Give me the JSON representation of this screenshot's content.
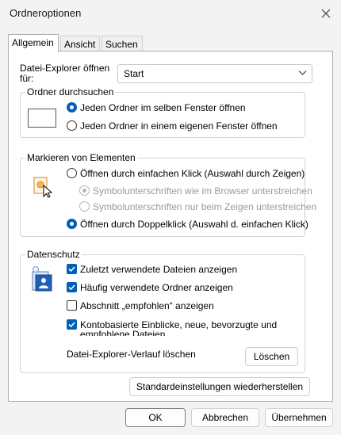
{
  "window": {
    "title": "Ordneroptionen"
  },
  "tabs": [
    {
      "label": "Allgemein",
      "active": true
    },
    {
      "label": "Ansicht",
      "active": false
    },
    {
      "label": "Suchen",
      "active": false
    }
  ],
  "explorer_open": {
    "label_line1": "Datei-Explorer öffnen",
    "label_line2": "für:",
    "value": "Start"
  },
  "browse_folders": {
    "legend": "Ordner durchsuchen",
    "option_same_window": "Jeden Ordner im selben Fenster öffnen",
    "option_new_window": "Jeden Ordner in einem eigenen Fenster öffnen"
  },
  "click_items": {
    "legend": "Markieren von Elementen",
    "option_single_click": "Öffnen durch einfachen Klick (Auswahl durch Zeigen)",
    "sub_browser_underline": "Symbolunterschriften wie im Browser unterstreichen",
    "sub_hover_underline": "Symbolunterschriften nur beim Zeigen unterstreichen",
    "option_double_click": "Öffnen durch Doppelklick (Auswahl d. einfachen Klick)"
  },
  "privacy": {
    "legend": "Datenschutz",
    "recent_files": "Zuletzt verwendete Dateien anzeigen",
    "frequent_folders": "Häufig verwendete Ordner anzeigen",
    "recommended_section": "Abschnitt „empfohlen“ anzeigen",
    "account_insights_line1": "Kontobasierte Einblicke, neue, bevorzugte und",
    "account_insights_line2": "empfohlene Dateien",
    "clear_history_label": "Datei-Explorer-Verlauf löschen",
    "clear_button": "Löschen"
  },
  "restore_defaults_button": "Standardeinstellungen wiederherstellen",
  "footer": {
    "ok": "OK",
    "cancel": "Abbrechen",
    "apply": "Übernehmen"
  },
  "colors": {
    "accent": "#005fb8",
    "panel_bg": "#ffffff",
    "window_bg": "#f3f3f3"
  }
}
